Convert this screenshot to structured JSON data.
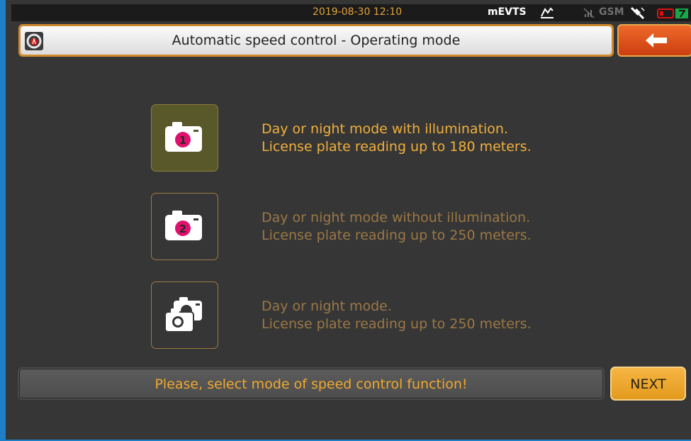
{
  "statusbar": {
    "datetime": "2019-08-30 12:10",
    "app_name": "mEVTS",
    "network": "GSM"
  },
  "header": {
    "title": "Automatic speed control - Operating mode",
    "back_icon": "arrow-left-icon"
  },
  "modes": [
    {
      "icon": "camera-1-icon",
      "line1": "Day or night mode with illumination.",
      "line2": "License plate reading up to 180 meters.",
      "selected": true
    },
    {
      "icon": "camera-2-icon",
      "line1": "Day or night mode without illumination.",
      "line2": "License plate reading up to 250 meters.",
      "selected": false
    },
    {
      "icon": "dual-camera-icon",
      "line1": "Day or night mode.",
      "line2": "License plate reading up to 250 meters.",
      "selected": false
    }
  ],
  "footer": {
    "message": "Please, select mode of speed control function!",
    "next_label": "NEXT"
  },
  "colors": {
    "background": "#363636",
    "accent": "#f0b03c",
    "selected_tile": "#59582b",
    "back_button": "#e0521c",
    "camera_badge": "#e0106e"
  }
}
